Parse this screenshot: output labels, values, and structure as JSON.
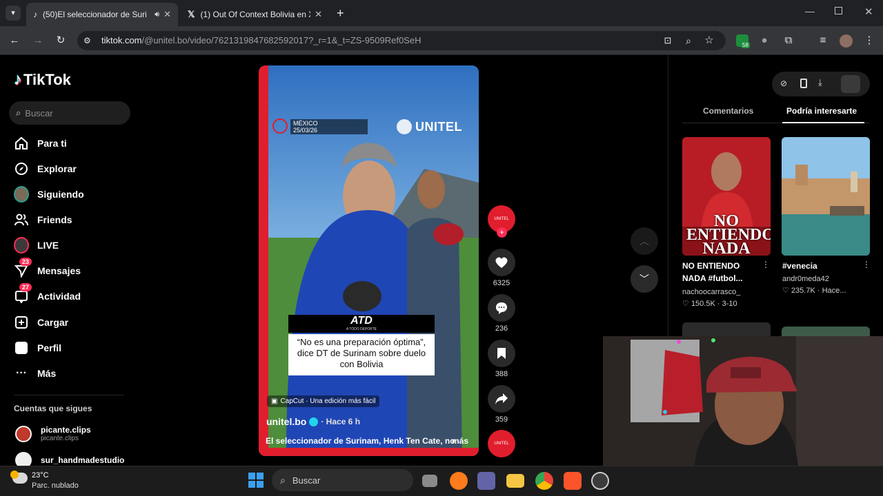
{
  "browser": {
    "tabs": [
      {
        "title": "(50)El seleccionador de Suri",
        "active": true
      },
      {
        "title": "(1) Out Of Context Bolivia en X",
        "active": false
      }
    ],
    "url_host": "tiktok.com",
    "url_path": "/@unitel.bo/video/7621319847682592017?_r=1&_t=ZS-9509Ref0SeH",
    "extension_badge": "58"
  },
  "tiktok": {
    "logo": "TikTok",
    "search_placeholder": "Buscar",
    "nav": [
      {
        "label": "Para ti"
      },
      {
        "label": "Explorar"
      },
      {
        "label": "Siguiendo"
      },
      {
        "label": "Friends"
      },
      {
        "label": "LIVE"
      },
      {
        "label": "Mensajes",
        "badge": "23"
      },
      {
        "label": "Actividad",
        "badge": "27"
      },
      {
        "label": "Cargar"
      },
      {
        "label": "Perfil"
      },
      {
        "label": "Más"
      }
    ],
    "following_title": "Cuentas que sigues",
    "following": [
      {
        "name": "picante.clips",
        "handle": "picante.clips"
      },
      {
        "name": "sur_handmadestudio",
        "handle": ""
      }
    ]
  },
  "video": {
    "location": "MÉXICO",
    "date": "25/03/26",
    "channel_logo": "UNITEL",
    "caption_brand": "ATD",
    "caption_brand_sub": "A TODO DEPORTE",
    "caption_text": "“No es una preparación óptima”, dice DT de Surinam sobre duelo con Bolivia",
    "capcut_label": "CapCut · Una edición más fácil",
    "author": "unitel.bo",
    "time_ago": "· Hace 6 h",
    "description": "El seleccionador de Surinam, Henk Ten Cate, no",
    "more": "más",
    "likes": "6325",
    "comments": "236",
    "saves": "388",
    "shares": "359"
  },
  "right_panel": {
    "tabs": [
      "Comentarios",
      "Podría interesarte"
    ],
    "active_tab": 1,
    "recommendations": [
      {
        "thumb_text": "NO ENTIENDO NADA",
        "title": "NO ENTIENDO NADA #futbol...",
        "author": "nachoocarrasco_",
        "likes": "150.5K",
        "date": "3-10"
      },
      {
        "title": "#venecia",
        "author": "andr0meda42",
        "likes": "235.7K",
        "date": "Hace..."
      }
    ]
  },
  "taskbar": {
    "temp": "23°C",
    "weather": "Parc. nublado",
    "search_placeholder": "Buscar"
  }
}
